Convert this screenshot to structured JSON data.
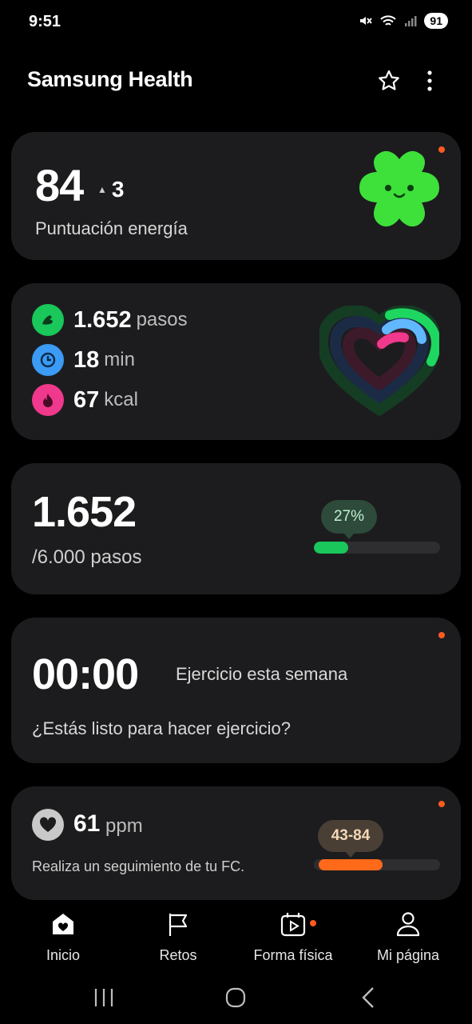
{
  "status_bar": {
    "time": "9:51",
    "battery": "91",
    "icons": [
      "mute-icon",
      "wifi-icon",
      "signal-icon",
      "battery-icon"
    ]
  },
  "header": {
    "title": "Samsung Health",
    "actions": [
      "star-icon",
      "more-vert-icon"
    ]
  },
  "energy": {
    "score": "84",
    "delta": "3",
    "label": "Puntuación energía"
  },
  "activity": {
    "steps_value": "1.652",
    "steps_unit": "pasos",
    "minutes_value": "18",
    "minutes_unit": "min",
    "kcal_value": "67",
    "kcal_unit": "kcal",
    "colors": {
      "steps": "#19c75a",
      "minutes": "#3b9bf5",
      "kcal": "#f0388c"
    }
  },
  "steps_card": {
    "value": "1.652",
    "goal": "/6.000 pasos",
    "percent_label": "27%",
    "progress": 0.27
  },
  "exercise": {
    "time": "00:00",
    "label": "Ejercicio esta semana",
    "prompt": "¿Estás listo para hacer ejercicio?"
  },
  "heart_rate": {
    "value": "61",
    "unit": "ppm",
    "message": "Realiza un seguimiento de tu FC.",
    "range": "43-84"
  },
  "bottom_nav": {
    "items": [
      {
        "label": "Inicio",
        "icon": "home-icon"
      },
      {
        "label": "Retos",
        "icon": "flag-icon"
      },
      {
        "label": "Forma física",
        "icon": "fitness-play-icon"
      },
      {
        "label": "Mi página",
        "icon": "person-icon"
      }
    ]
  },
  "system_nav": [
    "recents-icon",
    "home-circle-icon",
    "back-icon"
  ]
}
